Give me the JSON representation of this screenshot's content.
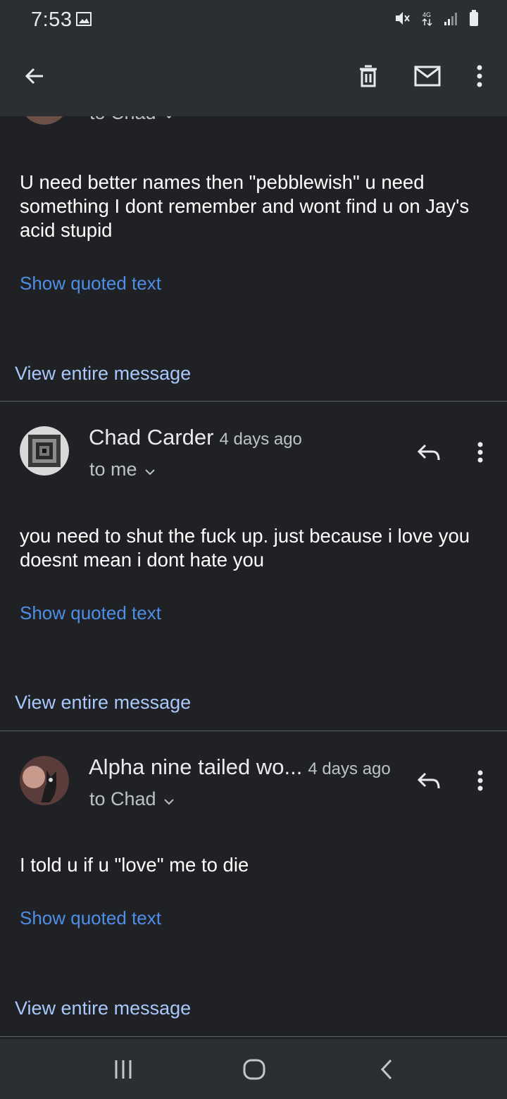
{
  "status": {
    "time": "7:53"
  },
  "colors": {
    "background": "#202124",
    "bar": "#2b2e33",
    "link": "#4d8ee7",
    "view_link": "#a8c7fa",
    "divider": "#5f6368"
  },
  "top_partial": {
    "recipient_text": "to Chad"
  },
  "messages": [
    {
      "body": "U need better names then \"pebblewish\" u need something I dont remember and wont find u on Jay's acid stupid",
      "show_quoted": "Show quoted text",
      "view_entire": "View entire message"
    },
    {
      "sender": "Chad Carder",
      "time": "4 days ago",
      "recipient": "to me",
      "body": "you need to shut the fuck up. just because i love you doesnt mean i dont hate you",
      "show_quoted": "Show quoted text",
      "view_entire": "View entire message"
    },
    {
      "sender": "Alpha nine tailed wo...",
      "time": "4 days ago",
      "recipient": "to Chad",
      "body": "I told u if u \"love\" me to die",
      "show_quoted": "Show quoted text",
      "view_entire": "View entire message"
    }
  ],
  "icons": {
    "back": "arrow-back-icon",
    "delete": "trash-icon",
    "mark_unread": "mail-icon",
    "more": "more-vert-icon",
    "reply": "reply-icon",
    "nav_recents": "recents-icon",
    "nav_home": "home-icon",
    "nav_back": "nav-back-icon"
  }
}
